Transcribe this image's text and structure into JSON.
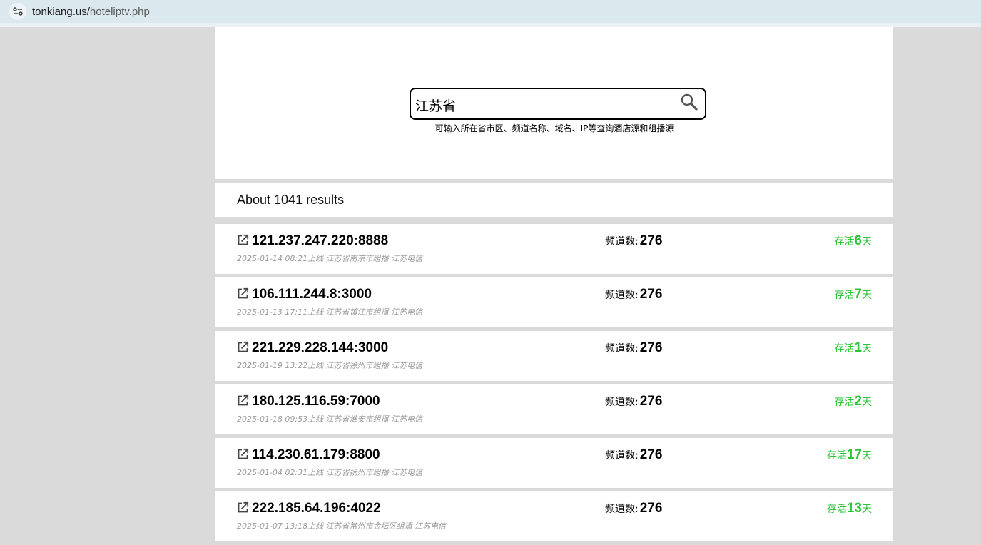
{
  "browser": {
    "url_host": "tonkiang.us/",
    "url_path": "hoteliptv.php"
  },
  "search": {
    "value": "江苏省",
    "hint": "可输入所在省市区、频道名称、域名、IP等查询酒店源和组播源"
  },
  "results_count": "About 1041 results",
  "results": [
    {
      "ip": "121.237.247.220:8888",
      "meta": "2025-01-14 08:21上线 江苏省南京市组播 江苏电信",
      "channels_label": "频道数:",
      "channels": "276",
      "alive_prefix": "存活",
      "alive_days": "6",
      "alive_suffix": "天"
    },
    {
      "ip": "106.111.244.8:3000",
      "meta": "2025-01-13 17:11上线 江苏省镇江市组播 江苏电信",
      "channels_label": "频道数:",
      "channels": "276",
      "alive_prefix": "存活",
      "alive_days": "7",
      "alive_suffix": "天"
    },
    {
      "ip": "221.229.228.144:3000",
      "meta": "2025-01-19 13:22上线 江苏省徐州市组播 江苏电信",
      "channels_label": "频道数:",
      "channels": "276",
      "alive_prefix": "存活",
      "alive_days": "1",
      "alive_suffix": "天"
    },
    {
      "ip": "180.125.116.59:7000",
      "meta": "2025-01-18 09:53上线 江苏省淮安市组播 江苏电信",
      "channels_label": "频道数:",
      "channels": "276",
      "alive_prefix": "存活",
      "alive_days": "2",
      "alive_suffix": "天"
    },
    {
      "ip": "114.230.61.179:8800",
      "meta": "2025-01-04 02:31上线 江苏省扬州市组播 江苏电信",
      "channels_label": "频道数:",
      "channels": "276",
      "alive_prefix": "存活",
      "alive_days": "17",
      "alive_suffix": "天"
    },
    {
      "ip": "222.185.64.196:4022",
      "meta": "2025-01-07 13:18上线 江苏省常州市金坛区组播 江苏电信",
      "channels_label": "频道数:",
      "channels": "276",
      "alive_prefix": "存活",
      "alive_days": "13",
      "alive_suffix": "天"
    }
  ],
  "colors": {
    "alive": "#2ec43a",
    "meta": "#9a9a9a",
    "background": "#dadada"
  },
  "icons": {
    "site_info": "tune-icon",
    "search": "search-icon",
    "external_link": "external-link-icon"
  }
}
